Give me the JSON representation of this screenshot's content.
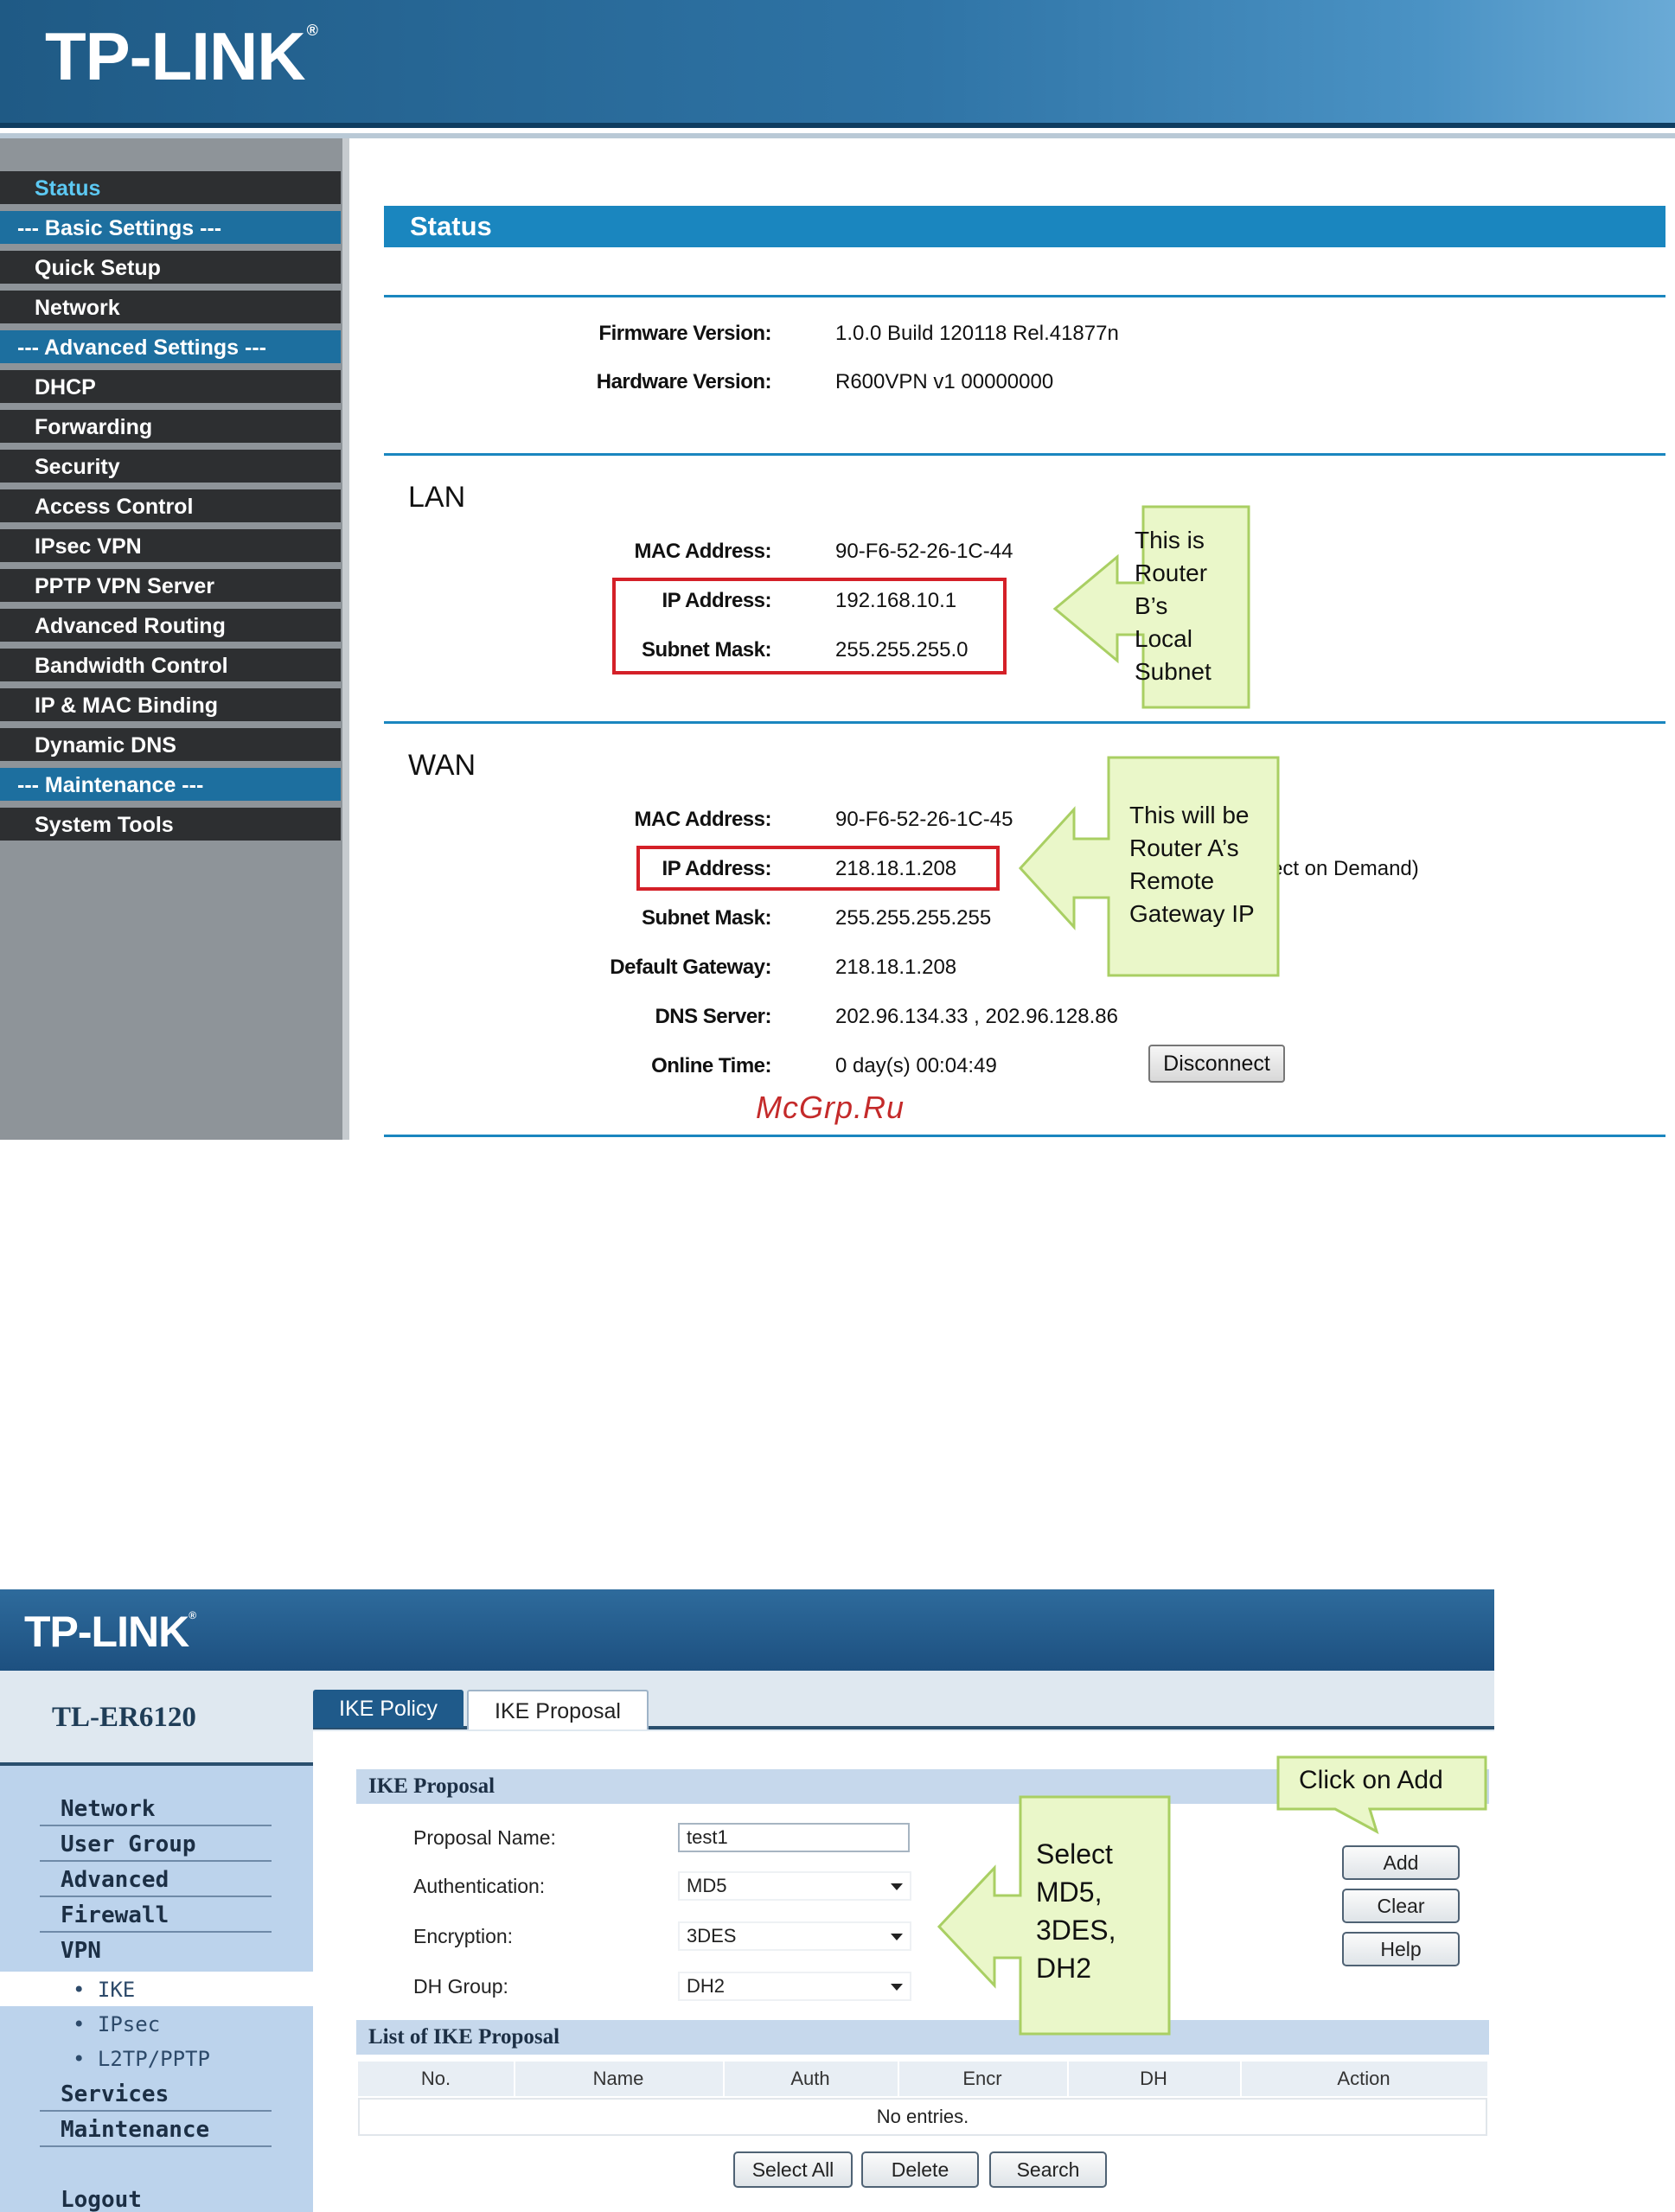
{
  "router_b": {
    "brand": "TP-LINK",
    "brand_mark": "®",
    "menu": [
      {
        "label": "Status",
        "kind": "item",
        "active": true
      },
      {
        "label": "--- Basic Settings ---",
        "kind": "section"
      },
      {
        "label": "Quick Setup",
        "kind": "item"
      },
      {
        "label": "Network",
        "kind": "item"
      },
      {
        "label": "--- Advanced Settings ---",
        "kind": "section"
      },
      {
        "label": "DHCP",
        "kind": "item"
      },
      {
        "label": "Forwarding",
        "kind": "item"
      },
      {
        "label": "Security",
        "kind": "item"
      },
      {
        "label": "Access Control",
        "kind": "item"
      },
      {
        "label": "IPsec VPN",
        "kind": "item"
      },
      {
        "label": "PPTP VPN Server",
        "kind": "item"
      },
      {
        "label": "Advanced Routing",
        "kind": "item"
      },
      {
        "label": "Bandwidth Control",
        "kind": "item"
      },
      {
        "label": "IP & MAC Binding",
        "kind": "item"
      },
      {
        "label": "Dynamic DNS",
        "kind": "item"
      },
      {
        "label": "--- Maintenance ---",
        "kind": "section"
      },
      {
        "label": "System Tools",
        "kind": "item"
      }
    ],
    "status_title": "Status",
    "firmware_label": "Firmware Version:",
    "firmware_value": "1.0.0 Build 120118 Rel.41877n",
    "hardware_label": "Hardware Version:",
    "hardware_value": "R600VPN v1 00000000",
    "lan": {
      "title": "LAN",
      "mac_label": "MAC Address:",
      "mac_value": "90-F6-52-26-1C-44",
      "ip_label": "IP Address:",
      "ip_value": "192.168.10.1",
      "mask_label": "Subnet Mask:",
      "mask_value": "255.255.255.0"
    },
    "wan": {
      "title": "WAN",
      "mac_label": "MAC Address:",
      "mac_value": "90-F6-52-26-1C-45",
      "ip_label": "IP Address:",
      "ip_value": "218.18.1.208",
      "ip_suffix": "ect on Demand)",
      "mask_label": "Subnet Mask:",
      "mask_value": "255.255.255.255",
      "gateway_label": "Default Gateway:",
      "gateway_value": "218.18.1.208",
      "dns_label": "DNS Server:",
      "dns_value": "202.96.134.33 , 202.96.128.86",
      "online_label": "Online Time:",
      "online_value": "0 day(s) 00:04:49",
      "disconnect_label": "Disconnect"
    },
    "callout_lan": [
      "This is",
      "Router",
      "B’s",
      "Local",
      "Subnet"
    ],
    "callout_wan": [
      "This will be",
      "Router A’s",
      "Remote",
      "Gateway IP"
    ],
    "watermark": "McGrp.Ru"
  },
  "router_a": {
    "brand": "TP-LINK",
    "brand_mark": "®",
    "model": "TL-ER6120",
    "nav": [
      {
        "label": "Network"
      },
      {
        "label": "User Group"
      },
      {
        "label": "Advanced"
      },
      {
        "label": "Firewall"
      },
      {
        "label": "VPN"
      }
    ],
    "vpn_sub": [
      "• IKE",
      "• IPsec",
      "• L2TP/PPTP"
    ],
    "nav_bottom": [
      {
        "label": "Services"
      },
      {
        "label": "Maintenance"
      }
    ],
    "logout": "Logout",
    "tabs": {
      "policy": "IKE Policy",
      "proposal": "IKE Proposal"
    },
    "form": {
      "section_title": "IKE Proposal",
      "name_label": "Proposal Name:",
      "name_value": "test1",
      "auth_label": "Authentication:",
      "auth_value": "MD5",
      "enc_label": "Encryption:",
      "enc_value": "3DES",
      "dh_label": "DH Group:",
      "dh_value": "DH2"
    },
    "buttons": {
      "add": "Add",
      "clear": "Clear",
      "help": "Help"
    },
    "list": {
      "section_title": "List of IKE Proposal",
      "columns": [
        "No.",
        "Name",
        "Auth",
        "Encr",
        "DH",
        "Action"
      ],
      "empty": "No entries."
    },
    "bottom_buttons": {
      "select_all": "Select All",
      "delete": "Delete",
      "search": "Search"
    },
    "callout_add": "Click on Add",
    "callout_select": [
      "Select",
      "MD5,",
      "3DES,",
      "DH2"
    ]
  },
  "colors": {
    "callout_fill": "#eaf7c9",
    "callout_stroke": "#a9cf63",
    "highlight_box": "#d42028",
    "status_blue": "#1a86bf",
    "menu_dark": "#2d2f31"
  }
}
